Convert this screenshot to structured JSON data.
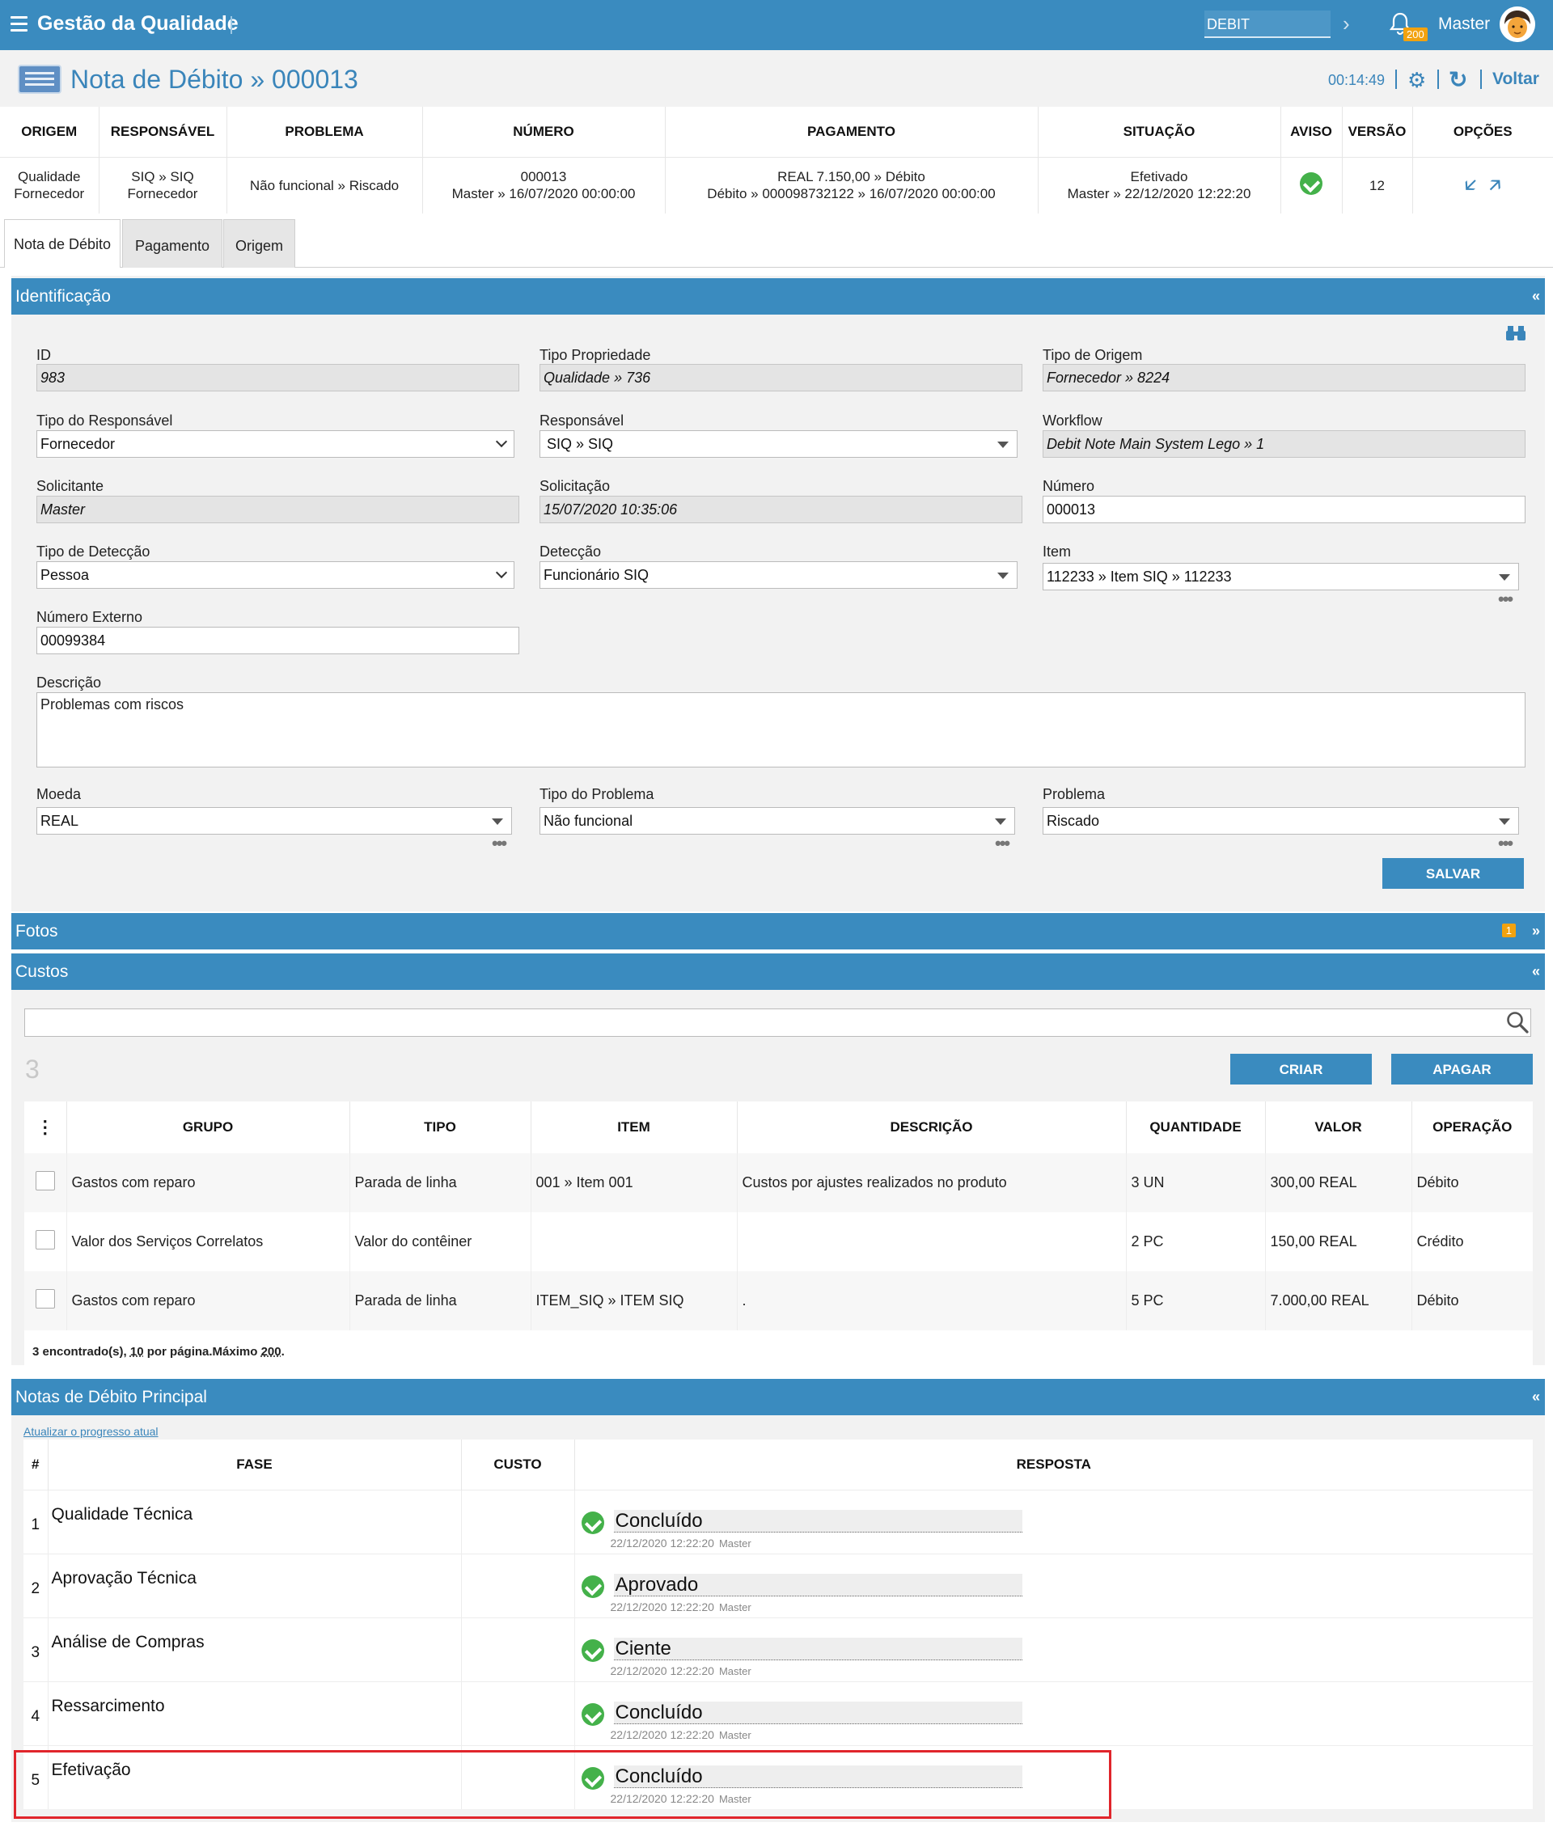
{
  "app": {
    "title": "Gestão da Qualidade",
    "search_value": "DEBIT",
    "user": "Master",
    "notifications": "200"
  },
  "header": {
    "title": "Nota de Débito » 000013",
    "clock": "00:14:49",
    "back_label": "Voltar"
  },
  "summary": {
    "columns": [
      "ORIGEM",
      "RESPONSÁVEL",
      "PROBLEMA",
      "NÚMERO",
      "PAGAMENTO",
      "SITUAÇÃO",
      "AVISO",
      "VERSÃO",
      "OPÇÕES"
    ],
    "row": {
      "origem_1": "Qualidade",
      "origem_2": "Fornecedor",
      "resp_1": "SIQ » SIQ",
      "resp_2": "Fornecedor",
      "problema": "Não funcional » Riscado",
      "numero_1": "000013",
      "numero_2": "Master » 16/07/2020 00:00:00",
      "pag_1": "REAL 7.150,00 » Débito",
      "pag_2": "Débito » 000098732122 » 16/07/2020 00:00:00",
      "sit_1": "Efetivado",
      "sit_2": "Master » 22/12/2020 12:22:20",
      "versao": "12"
    }
  },
  "tabs": [
    "Nota de Débito",
    "Pagamento",
    "Origem"
  ],
  "identificacao": {
    "title": "Identificação",
    "collapse": "«",
    "fields": {
      "id": {
        "label": "ID",
        "value": "983"
      },
      "tipo_prop": {
        "label": "Tipo Propriedade",
        "value": "Qualidade » 736"
      },
      "tipo_origem": {
        "label": "Tipo de Origem",
        "value": "Fornecedor » 8224"
      },
      "tipo_resp": {
        "label": "Tipo do Responsável",
        "value": "Fornecedor"
      },
      "responsavel": {
        "label": "Responsável",
        "value": "SIQ  »  SIQ"
      },
      "workflow": {
        "label": "Workflow",
        "value": "Debit Note Main System Lego » 1"
      },
      "solicitante": {
        "label": "Solicitante",
        "value": "Master"
      },
      "solicitacao": {
        "label": "Solicitação",
        "value": "15/07/2020 10:35:06"
      },
      "numero": {
        "label": "Número",
        "value": "000013"
      },
      "tipo_det": {
        "label": "Tipo de Detecção",
        "value": "Pessoa"
      },
      "deteccao": {
        "label": "Detecção",
        "value": "Funcionário SIQ"
      },
      "item": {
        "label": "Item",
        "value": "112233 » Item SIQ » 112233"
      },
      "num_externo": {
        "label": "Número Externo",
        "value": "00099384"
      },
      "descricao": {
        "label": "Descrição",
        "value": "Problemas com riscos"
      },
      "moeda": {
        "label": "Moeda",
        "value": "REAL"
      },
      "tipo_problema": {
        "label": "Tipo do Problema",
        "value": "Não funcional"
      },
      "problema": {
        "label": "Problema",
        "value": "Riscado"
      }
    },
    "save_label": "SALVAR"
  },
  "fotos": {
    "title": "Fotos",
    "badge": "1",
    "expand": "»"
  },
  "custos": {
    "title": "Custos",
    "collapse": "«",
    "count": "3",
    "create_label": "CRIAR",
    "delete_label": "APAGAR",
    "columns": [
      "GRUPO",
      "TIPO",
      "ITEM",
      "DESCRIÇÃO",
      "QUANTIDADE",
      "VALOR",
      "OPERAÇÃO"
    ],
    "rows": [
      {
        "grupo": "Gastos com reparo",
        "tipo": "Parada de linha",
        "item": "001 » Item 001",
        "descricao": "Custos por ajustes realizados no produto",
        "quantidade": "3 UN",
        "valor": "300,00 REAL",
        "operacao": "Débito"
      },
      {
        "grupo": "Valor dos Serviços Correlatos",
        "tipo": "Valor do contêiner",
        "item": "",
        "descricao": "",
        "quantidade": "2 PC",
        "valor": "150,00 REAL",
        "operacao": "Crédito"
      },
      {
        "grupo": "Gastos com reparo",
        "tipo": "Parada de linha",
        "item": "ITEM_SIQ » ITEM SIQ",
        "descricao": ".",
        "quantidade": "5 PC",
        "valor": "7.000,00 REAL",
        "operacao": "Débito"
      }
    ],
    "footer": {
      "found": "3 encontrado(s), ",
      "per_page": "10",
      "per_page_suffix": " por página.Máximo ",
      "max": "200",
      "end": "."
    }
  },
  "notas": {
    "title": "Notas de Débito Principal",
    "collapse": "«",
    "update_link": "Atualizar o progresso atual",
    "columns": [
      "#",
      "FASE",
      "CUSTO",
      "RESPOSTA"
    ],
    "rows": [
      {
        "n": "1",
        "fase": "Qualidade Técnica",
        "resposta": "Concluído",
        "data": "22/12/2020 12:22:20",
        "user": "Master"
      },
      {
        "n": "2",
        "fase": "Aprovação Técnica",
        "resposta": "Aprovado",
        "data": "22/12/2020 12:22:20",
        "user": "Master"
      },
      {
        "n": "3",
        "fase": "Análise de Compras",
        "resposta": "Ciente",
        "data": "22/12/2020 12:22:20",
        "user": "Master"
      },
      {
        "n": "4",
        "fase": "Ressarcimento",
        "resposta": "Concluído",
        "data": "22/12/2020 12:22:20",
        "user": "Master"
      },
      {
        "n": "5",
        "fase": "Efetivação",
        "resposta": "Concluído",
        "data": "22/12/2020 12:22:20",
        "user": "Master"
      }
    ]
  },
  "colors": {
    "primary": "#3a8bbf",
    "success": "#44b14a",
    "highlight": "#e0252b",
    "badge": "#f2a20f"
  }
}
